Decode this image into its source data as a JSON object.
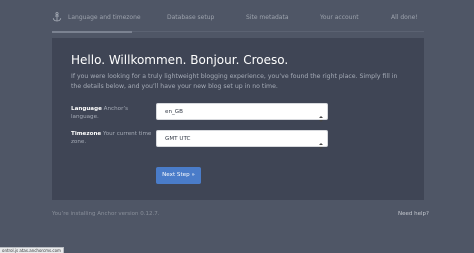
{
  "steps": {
    "items": [
      {
        "label": "Language and timezone"
      },
      {
        "label": "Database setup"
      },
      {
        "label": "Site metadata"
      },
      {
        "label": "Your account"
      },
      {
        "label": "All done!"
      }
    ]
  },
  "main": {
    "title": "Hello. Willkommen. Bonjour. Croeso.",
    "intro": "If you were looking for a truly lightweight blogging experience, you’ve found the right place. Simply fill in the details below, and you’ll have your new blog set up in no time."
  },
  "form": {
    "language": {
      "label": "Language",
      "help": "Anchor’s language.",
      "value": "en_GB"
    },
    "timezone": {
      "label": "Timezone",
      "help": "Your current time zone.",
      "value": "GMT UTC"
    },
    "next_label": "Next Step »"
  },
  "footer": {
    "version_text": "You’re installing Anchor version 0.12.7.",
    "help_link": "Need help?"
  },
  "status": {
    "text": "ontrol.js atas.anchorcms.com"
  },
  "colors": {
    "background": "#4f5666",
    "panel": "#3f4555",
    "accent": "#4a7cc9"
  },
  "icons": {
    "logo": "anchor-icon",
    "caret": "up-down-caret-icon"
  }
}
